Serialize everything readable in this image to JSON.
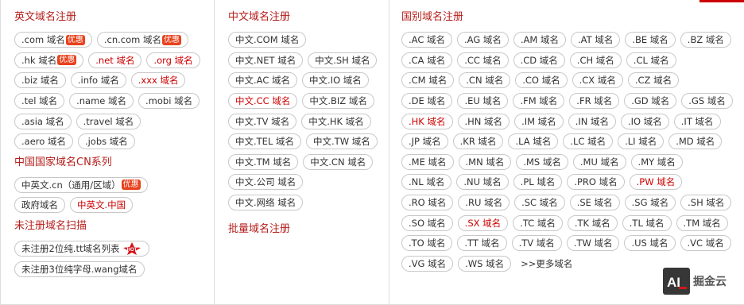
{
  "colors": {
    "accent": "#b5201d",
    "link_red": "#cc0000",
    "badge": "#e8411c"
  },
  "english": {
    "title": "英文域名注册",
    "rows": [
      [
        {
          "label": ".com 域名",
          "badge": "优惠"
        },
        {
          "label": ".cn.com 域名",
          "badge": "优惠"
        }
      ],
      [
        {
          "label": ".hk 域名",
          "badge": "优惠"
        },
        {
          "label": ".net 域名",
          "red": true
        },
        {
          "label": ".org 域名",
          "red": true
        }
      ],
      [
        {
          "label": ".biz 域名"
        },
        {
          "label": ".info 域名"
        },
        {
          "label": ".xxx 域名",
          "red": true
        }
      ],
      [
        {
          "label": ".tel 域名"
        },
        {
          "label": ".name 域名"
        },
        {
          "label": ".mobi 域名"
        }
      ],
      [
        {
          "label": ".asia 域名"
        },
        {
          "label": ".travel 域名"
        }
      ],
      [
        {
          "label": ".aero 域名"
        },
        {
          "label": ".jobs 域名"
        }
      ]
    ]
  },
  "cn_series": {
    "title": "中国国家域名CN系列",
    "rows": [
      [
        {
          "label": "中英文.cn（通用/区域）",
          "badge": "优惠"
        }
      ],
      [
        {
          "label": "政府域名"
        },
        {
          "label": "中英文.中国",
          "red": true
        }
      ]
    ]
  },
  "unregistered": {
    "title": "未注册域名扫描",
    "rows": [
      [
        {
          "label": "未注册2位纯.tt域名列表",
          "hot": true
        }
      ],
      [
        {
          "label": "未注册3位纯字母.wang域名"
        }
      ]
    ]
  },
  "chinese": {
    "title": "中文域名注册",
    "rows": [
      [
        {
          "label": "中文.COM 域名"
        }
      ],
      [
        {
          "label": "中文.NET 域名"
        },
        {
          "label": "中文.SH 域名"
        }
      ],
      [
        {
          "label": "中文.AC 域名"
        },
        {
          "label": "中文.IO 域名"
        }
      ],
      [
        {
          "label": "中文.CC 域名",
          "red": true
        },
        {
          "label": "中文.BIZ 域名"
        }
      ],
      [
        {
          "label": "中文.TV 域名"
        },
        {
          "label": "中文.HK 域名"
        }
      ],
      [
        {
          "label": "中文.TEL 域名"
        },
        {
          "label": "中文.TW 域名"
        }
      ],
      [
        {
          "label": "中文.TM 域名"
        },
        {
          "label": "中文.CN 域名"
        }
      ],
      [
        {
          "label": "中文.公司 域名"
        }
      ],
      [
        {
          "label": "中文.网络 域名"
        }
      ]
    ]
  },
  "bulk": {
    "title": "批量域名注册"
  },
  "country": {
    "title": "国别域名注册",
    "rows": [
      [
        {
          "label": ".AC 域名"
        },
        {
          "label": ".AG 域名"
        },
        {
          "label": ".AM 域名"
        },
        {
          "label": ".AT 域名"
        },
        {
          "label": ".BE 域名"
        },
        {
          "label": ".BZ 域名"
        }
      ],
      [
        {
          "label": ".CA 域名"
        },
        {
          "label": ".CC 域名"
        },
        {
          "label": ".CD 域名"
        },
        {
          "label": ".CH 域名"
        },
        {
          "label": ".CL 域名"
        }
      ],
      [
        {
          "label": ".CM 域名"
        },
        {
          "label": ".CN 域名"
        },
        {
          "label": ".CO 域名"
        },
        {
          "label": ".CX 域名"
        },
        {
          "label": ".CZ 域名"
        }
      ],
      [
        {
          "label": ".DE 域名"
        },
        {
          "label": ".EU 域名"
        },
        {
          "label": ".FM 域名"
        },
        {
          "label": ".FR 域名"
        },
        {
          "label": ".GD 域名"
        },
        {
          "label": ".GS 域名"
        }
      ],
      [
        {
          "label": ".HK 域名",
          "red": true
        },
        {
          "label": ".HN 域名"
        },
        {
          "label": ".IM 域名"
        },
        {
          "label": ".IN 域名"
        },
        {
          "label": ".IO 域名"
        },
        {
          "label": ".IT 域名"
        }
      ],
      [
        {
          "label": ".JP 域名"
        },
        {
          "label": ".KR 域名"
        },
        {
          "label": ".LA 域名"
        },
        {
          "label": ".LC 域名"
        },
        {
          "label": ".LI 域名"
        },
        {
          "label": ".MD 域名"
        }
      ],
      [
        {
          "label": ".ME 域名"
        },
        {
          "label": ".MN 域名"
        },
        {
          "label": ".MS 域名"
        },
        {
          "label": ".MU 域名"
        },
        {
          "label": ".MY 域名"
        }
      ],
      [
        {
          "label": ".NL 域名"
        },
        {
          "label": ".NU 域名"
        },
        {
          "label": ".PL 域名"
        },
        {
          "label": ".PRO 域名"
        },
        {
          "label": ".PW 域名",
          "red": true
        }
      ],
      [
        {
          "label": ".RO 域名"
        },
        {
          "label": ".RU 域名"
        },
        {
          "label": ".SC 域名"
        },
        {
          "label": ".SE 域名"
        },
        {
          "label": ".SG 域名"
        },
        {
          "label": ".SH 域名"
        }
      ],
      [
        {
          "label": ".SO 域名"
        },
        {
          "label": ".SX 域名",
          "red": true
        },
        {
          "label": ".TC 域名"
        },
        {
          "label": ".TK 域名"
        },
        {
          "label": ".TL 域名"
        },
        {
          "label": ".TM 域名"
        }
      ],
      [
        {
          "label": ".TO 域名"
        },
        {
          "label": ".TT 域名"
        },
        {
          "label": ".TV 域名"
        },
        {
          "label": ".TW 域名"
        },
        {
          "label": ".US 域名"
        },
        {
          "label": ".VC 域名"
        }
      ],
      [
        {
          "label": ".VG 域名"
        },
        {
          "label": ".WS 域名"
        }
      ]
    ],
    "more": ">>更多域名"
  },
  "hot_label": "HOT",
  "watermark": {
    "logo_text": "AI",
    "text": "掘金云"
  }
}
